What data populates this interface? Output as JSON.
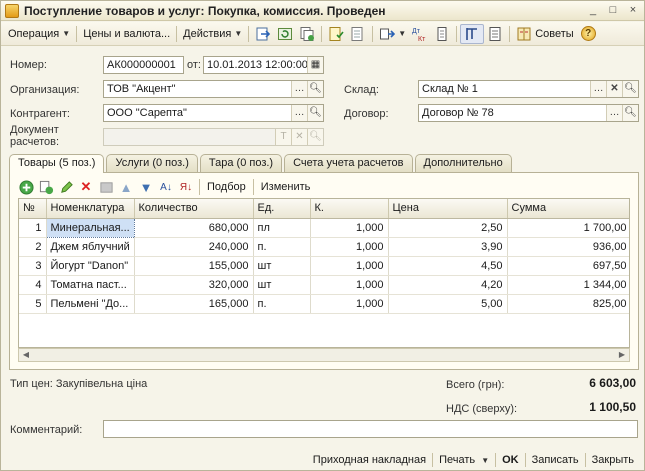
{
  "window": {
    "title": "Поступление товаров и услуг: Покупка, комиссия. Проведен",
    "buttons": [
      "_",
      "□",
      "×"
    ]
  },
  "toolbar": {
    "operation_label": "Операция",
    "prices_label": "Цены и валюта...",
    "actions_label": "Действия",
    "advice_label": "Советы",
    "help_label": "?"
  },
  "form": {
    "number_label": "Номер:",
    "number_value": "АК000000001",
    "date_label": "от:",
    "date_value": "10.01.2013 12:00:00",
    "org_label": "Организация:",
    "org_value": "ТОВ \"Акцент\"",
    "warehouse_label": "Склад:",
    "warehouse_value": "Склад № 1",
    "contractor_label": "Контрагент:",
    "contractor_value": "ООО \"Сарепта\"",
    "contract_label": "Договор:",
    "contract_value": "Договор № 78",
    "doc_label_1": "Документ",
    "doc_label_2": "расчетов:",
    "doc_value": ""
  },
  "tabs": [
    {
      "label": "Товары (5 поз.)",
      "active": true
    },
    {
      "label": "Услуги (0 поз.)",
      "active": false
    },
    {
      "label": "Тара (0 поз.)",
      "active": false
    },
    {
      "label": "Счета учета расчетов",
      "active": false
    },
    {
      "label": "Дополнительно",
      "active": false
    }
  ],
  "tab_toolbar": {
    "selection_label": "Подбор",
    "change_label": "Изменить"
  },
  "table": {
    "headers": [
      "№",
      "Номенклатура",
      "Количество",
      "Ед.",
      "К.",
      "Цена",
      "Сумма"
    ],
    "rows": [
      [
        "1",
        "Минеральная...",
        "680,000",
        "пл",
        "1,000",
        "2,50",
        "1 700,00"
      ],
      [
        "2",
        "Джем яблучний",
        "240,000",
        "п.",
        "1,000",
        "3,90",
        "936,00"
      ],
      [
        "3",
        "Йогурт \"Danon\"",
        "155,000",
        "шт",
        "1,000",
        "4,50",
        "697,50"
      ],
      [
        "4",
        "Томатна паст...",
        "320,000",
        "шт",
        "1,000",
        "4,20",
        "1 344,00"
      ],
      [
        "5",
        "Пельмені \"До...",
        "165,000",
        "п.",
        "1,000",
        "5,00",
        "825,00"
      ]
    ]
  },
  "summary": {
    "price_type": "Тип цен: Закупівельна ціна",
    "total_label": "Всего (грн):",
    "total_value": "6 603,00",
    "vat_label": "НДС (сверху):",
    "vat_value": "1 100,50"
  },
  "comment": {
    "label": "Комментарий:",
    "value": ""
  },
  "bottom": {
    "invoice_label": "Приходная накладная",
    "print_label": "Печать",
    "ok_label": "OK",
    "save_label": "Записать",
    "close_label": "Закрыть"
  }
}
